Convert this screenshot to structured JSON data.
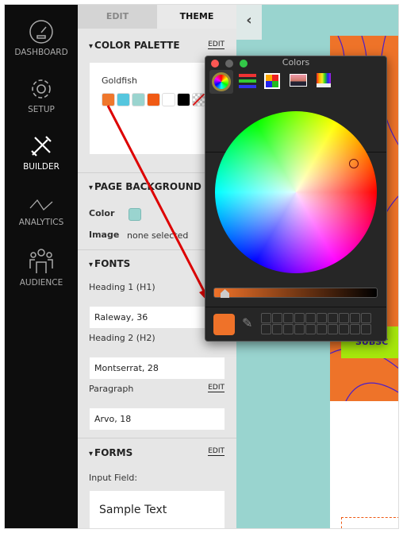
{
  "sidebar": {
    "items": [
      {
        "label": "DASHBOARD",
        "icon": "dashboard-gauge-icon"
      },
      {
        "label": "SETUP",
        "icon": "gear-icon"
      },
      {
        "label": "BUILDER",
        "icon": "tools-icon",
        "active": true
      },
      {
        "label": "ANALYTICS",
        "icon": "line-chart-icon"
      },
      {
        "label": "AUDIENCE",
        "icon": "people-icon"
      }
    ]
  },
  "panel": {
    "tabs": [
      "EDIT",
      "THEME"
    ],
    "color_palette": {
      "title": "COLOR PALETTE",
      "edit": "EDIT",
      "name": "Goldfish",
      "swatches": [
        "#ef772c",
        "#55c6de",
        "#9ad4cf",
        "#f05a14",
        "#ffffff",
        "#000000",
        "transparent"
      ]
    },
    "page_background": {
      "title": "PAGE BACKGROUND",
      "color_label": "Color",
      "color": "#9ad4cf",
      "image_label": "Image",
      "image_value": "none selected"
    },
    "fonts": {
      "title": "FONTS",
      "h1_label": "Heading 1 (H1)",
      "h1_value": "Raleway, 36",
      "h2_label": "Heading 2 (H2)",
      "h2_value": "Montserrat, 28",
      "p_label": "Paragraph",
      "p_edit": "EDIT",
      "p_value": "Arvo, 18"
    },
    "forms": {
      "title": "FORMS",
      "edit": "EDIT",
      "input_label": "Input Field:",
      "input_sample": "Sample Text"
    }
  },
  "preview": {
    "subscribe": "SUBSC",
    "accent": "#a6e80c"
  },
  "colors_window": {
    "title": "Colors",
    "selected_color": "#ef7229",
    "tabs": [
      "color-wheel-icon",
      "sliders-icon",
      "palettes-icon",
      "image-palette-icon",
      "pencils-icon"
    ],
    "brightness": 1.0
  }
}
